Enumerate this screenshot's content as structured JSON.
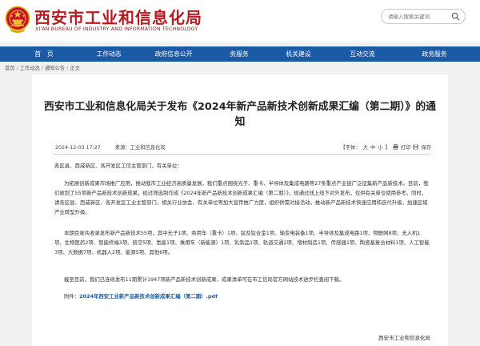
{
  "header": {
    "title_cn": "西安市工业和信息化局",
    "title_en": "XI'AN BUREAU OF INDUSTRY AND INFORMATION TECHNOLOGY",
    "search_placeholder": "请输入搜索关键词"
  },
  "nav": {
    "items": [
      {
        "label": "首　页"
      },
      {
        "label": "工作动态"
      },
      {
        "label": "政府信息公开"
      },
      {
        "label": "务服务"
      },
      {
        "label": "机关建设"
      },
      {
        "label": "互动交流"
      },
      {
        "label": "政务服务"
      }
    ]
  },
  "breadcrumb": {
    "items": [
      "首页",
      "工作动态",
      "通知公告",
      "正文"
    ],
    "separator": "/"
  },
  "article": {
    "title": "西安市工业和信息化局关于发布《2024年新产品新技术创新成果汇编（第二期）》的通知",
    "date": "2024-12-03 17:27",
    "source": "来源：工业和信息化局",
    "font_label": "【字体：",
    "font_large": "大",
    "font_medium": "中",
    "font_small": "小",
    "font_close": "】",
    "print_label": "打印",
    "save_label": "保存",
    "salutation": "各区县、西咸新区、各开发区工信主管部门，有关单位：",
    "para1": "为拓展创新成果市场推广应用，推动我市工业经济高质量发展，我们重点围绕光子、重卡、半导体及集成电路等27条重点产业链广泛征集新产品新技术。目前，我们收到了55项新产品新技术创新成果，经过筛选制作成《2024年新产品新技术创新成果汇编（第二期）》，现通过线上线下对外发布，仅供有关单位使用参考。同时，请各区县、西咸新区、各开发区工业主管部门，相关行业协会、有关单位等加大宣传推广力度，组织供需对接活动，推动新产品新技术快速应用和迭代升级，加速区域产业转型升级。",
    "para2": "本期目录共收录发布新产品新技术55项，其中光子1项、商用车（重卡）1项、钛及钛合金1项、输变电装备1项、半导体及集成电路1项、物联网8项、无人机1项、生物医药2项、智能终端3项、航空5项、氢能1项、乘用车（新能源）1项、乳制品1项、轨道交通2项、增材制造1项、传感器1项、陶瓷基复合材料1项、人工智能3项、大数据7项、机器人2项、能源5项、其他6项。",
    "para3": "截至目前，我们已连续发布11期累计1947项新产品新技术创新成果，成果清单可在市工信局官方网站技术进步栏查阅下载。",
    "attachment_label": "附件：",
    "attachment_link": "2024年西安工业新产品新技术创新成果汇编（第二期）.pdf",
    "signature": "西安市工业和信息化局"
  },
  "colors": {
    "brand_red": "#b81c22",
    "nav_blue": "#1b5aa4",
    "page_bg": "#f1f1f1"
  }
}
